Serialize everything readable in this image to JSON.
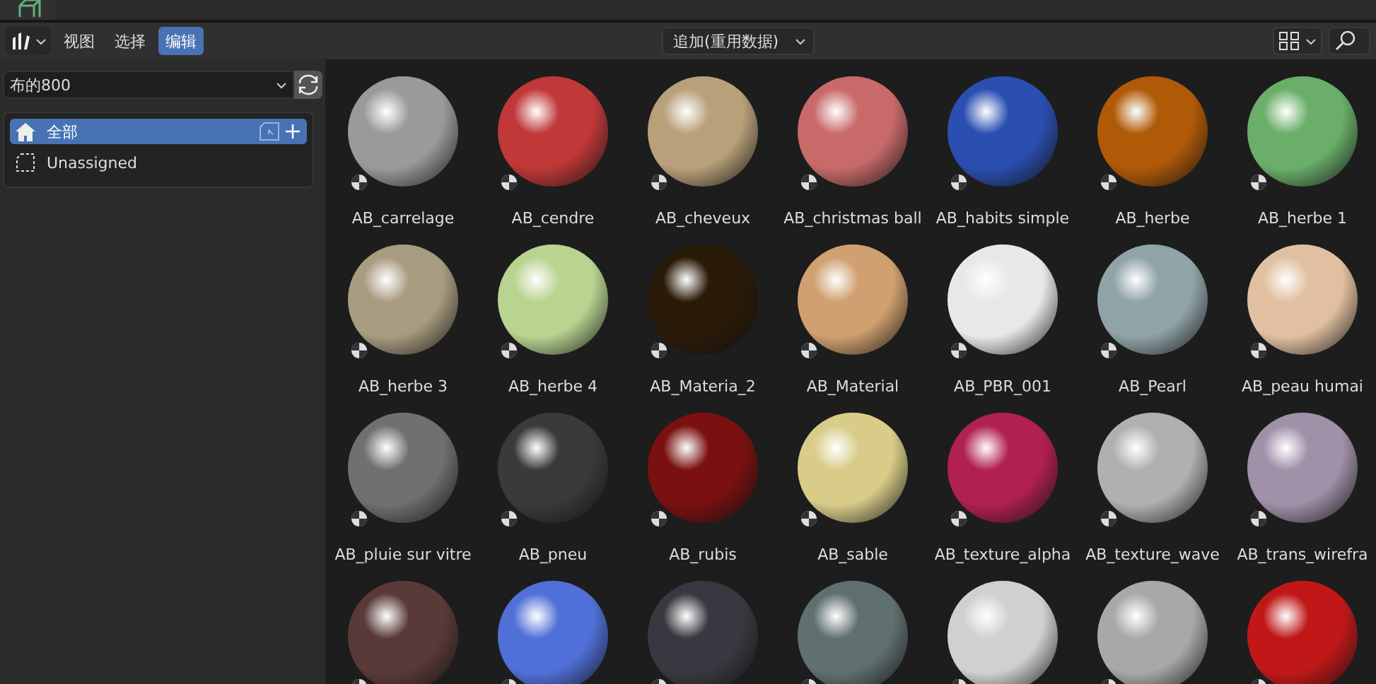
{
  "header": {
    "menus": [
      {
        "label": "视图",
        "selected": false
      },
      {
        "label": "选择",
        "selected": false
      },
      {
        "label": "编辑",
        "selected": true
      }
    ],
    "import_mode": "追加(重用数据)"
  },
  "sidebar": {
    "library": "布的800",
    "catalogs": [
      {
        "label": "全部",
        "kind": "home",
        "selected": true
      },
      {
        "label": "Unassigned",
        "kind": "unassigned",
        "selected": false
      }
    ]
  },
  "assets": [
    {
      "label": "AB_carrelage",
      "color": "#9a9a9a"
    },
    {
      "label": "AB_cendre",
      "color": "#c03838"
    },
    {
      "label": "AB_cheveux",
      "color": "#b8a07a"
    },
    {
      "label": "AB_christmas ball",
      "color": "#c86a6a"
    },
    {
      "label": "AB_habits simple",
      "color": "#2a4fb0"
    },
    {
      "label": "AB_herbe",
      "color": "#b05a08"
    },
    {
      "label": "AB_herbe 1",
      "color": "#6aae6a"
    },
    {
      "label": "AB_herbe 3",
      "color": "#a89c80"
    },
    {
      "label": "AB_herbe 4",
      "color": "#b8d490"
    },
    {
      "label": "AB_Materia_2",
      "color": "#2a1a08"
    },
    {
      "label": "AB_Material",
      "color": "#d0a070"
    },
    {
      "label": "AB_PBR_001",
      "color": "#e8e8e8"
    },
    {
      "label": "AB_Pearl",
      "color": "#90a4a8"
    },
    {
      "label": "AB_peau humai",
      "color": "#e0c0a0"
    },
    {
      "label": "AB_pluie sur vitre",
      "color": "#707070"
    },
    {
      "label": "AB_pneu",
      "color": "#3a3a3a"
    },
    {
      "label": "AB_rubis",
      "color": "#7a1010"
    },
    {
      "label": "AB_sable",
      "color": "#d8cc88"
    },
    {
      "label": "AB_texture_alpha",
      "color": "#b02050"
    },
    {
      "label": "AB_texture_wave",
      "color": "#b0b0b0"
    },
    {
      "label": "AB_trans_wirefra",
      "color": "#a090a8"
    },
    {
      "color": "#5a3a38"
    },
    {
      "color": "#5070d8"
    },
    {
      "color": "#383840"
    },
    {
      "color": "#607070"
    },
    {
      "color": "#d0d0d0"
    },
    {
      "color": "#a8a8a8"
    },
    {
      "color": "#c01818"
    }
  ]
}
